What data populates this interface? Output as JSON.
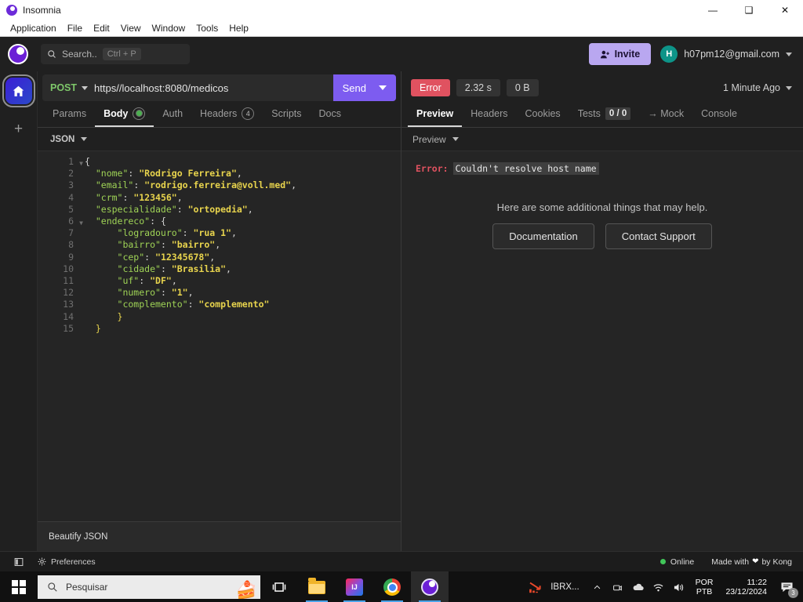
{
  "window": {
    "title": "Insomnia",
    "logo_icon": "insomnia-logo-icon",
    "minimize_label": "—",
    "maximize_label": "❑",
    "close_label": "✕"
  },
  "menubar": {
    "items": [
      {
        "label": "Application"
      },
      {
        "label": "File"
      },
      {
        "label": "Edit"
      },
      {
        "label": "View"
      },
      {
        "label": "Window"
      },
      {
        "label": "Tools"
      },
      {
        "label": "Help"
      }
    ]
  },
  "apptop": {
    "search": {
      "placeholder": "Search..",
      "shortcut": "Ctrl + P",
      "icon": "search-icon"
    },
    "invite_label": "Invite",
    "invite_icon": "add-user-icon",
    "account": {
      "initial": "H",
      "email": "h07pm12@gmail.com"
    }
  },
  "rail": {
    "home_icon": "home-icon",
    "add_label": "+"
  },
  "request": {
    "method": "POST",
    "url": "https//localhost:8080/medicos",
    "send_label": "Send",
    "tabs": [
      {
        "label": "Params",
        "active": false
      },
      {
        "label": "Body",
        "active": true,
        "badge_dot": true
      },
      {
        "label": "Auth",
        "active": false
      },
      {
        "label": "Headers",
        "active": false,
        "badge": "4"
      },
      {
        "label": "Scripts",
        "active": false
      },
      {
        "label": "Docs",
        "active": false
      }
    ],
    "editor": {
      "mode": "JSON",
      "beautify_label": "Beautify JSON",
      "lines": [
        {
          "n": 1,
          "fold": true,
          "tokens": [
            {
              "t": "{",
              "c": "p"
            }
          ]
        },
        {
          "n": 2,
          "fold": false,
          "tokens": [
            {
              "t": "  \"nome\"",
              "c": "k"
            },
            {
              "t": ": ",
              "c": "p"
            },
            {
              "t": "\"Rodrigo Ferreira\"",
              "c": "s"
            },
            {
              "t": ",",
              "c": "p"
            }
          ]
        },
        {
          "n": 3,
          "fold": false,
          "tokens": [
            {
              "t": "  \"email\"",
              "c": "k"
            },
            {
              "t": ": ",
              "c": "p"
            },
            {
              "t": "\"rodrigo.ferreira@voll.med\"",
              "c": "s"
            },
            {
              "t": ",",
              "c": "p"
            }
          ]
        },
        {
          "n": 4,
          "fold": false,
          "tokens": [
            {
              "t": "  \"crm\"",
              "c": "k"
            },
            {
              "t": ": ",
              "c": "p"
            },
            {
              "t": "\"123456\"",
              "c": "s"
            },
            {
              "t": ",",
              "c": "p"
            }
          ]
        },
        {
          "n": 5,
          "fold": false,
          "tokens": [
            {
              "t": "  \"especialidade\"",
              "c": "k"
            },
            {
              "t": ": ",
              "c": "p"
            },
            {
              "t": "\"ortopedia\"",
              "c": "s"
            },
            {
              "t": ",",
              "c": "p"
            }
          ]
        },
        {
          "n": 6,
          "fold": true,
          "tokens": [
            {
              "t": "  \"endereco\"",
              "c": "k"
            },
            {
              "t": ": ",
              "c": "p"
            },
            {
              "t": "{",
              "c": "p"
            }
          ]
        },
        {
          "n": 7,
          "fold": false,
          "tokens": [
            {
              "t": "      \"logradouro\"",
              "c": "k"
            },
            {
              "t": ": ",
              "c": "p"
            },
            {
              "t": "\"rua 1\"",
              "c": "s"
            },
            {
              "t": ",",
              "c": "p"
            }
          ]
        },
        {
          "n": 8,
          "fold": false,
          "tokens": [
            {
              "t": "      \"bairro\"",
              "c": "k"
            },
            {
              "t": ": ",
              "c": "p"
            },
            {
              "t": "\"bairro\"",
              "c": "s"
            },
            {
              "t": ",",
              "c": "p"
            }
          ]
        },
        {
          "n": 9,
          "fold": false,
          "tokens": [
            {
              "t": "      \"cep\"",
              "c": "k"
            },
            {
              "t": ": ",
              "c": "p"
            },
            {
              "t": "\"12345678\"",
              "c": "s"
            },
            {
              "t": ",",
              "c": "p"
            }
          ]
        },
        {
          "n": 10,
          "fold": false,
          "tokens": [
            {
              "t": "      \"cidade\"",
              "c": "k"
            },
            {
              "t": ": ",
              "c": "p"
            },
            {
              "t": "\"Brasilia\"",
              "c": "s"
            },
            {
              "t": ",",
              "c": "p"
            }
          ]
        },
        {
          "n": 11,
          "fold": false,
          "tokens": [
            {
              "t": "      \"uf\"",
              "c": "k"
            },
            {
              "t": ": ",
              "c": "p"
            },
            {
              "t": "\"DF\"",
              "c": "s"
            },
            {
              "t": ",",
              "c": "p"
            }
          ]
        },
        {
          "n": 12,
          "fold": false,
          "tokens": [
            {
              "t": "      \"numero\"",
              "c": "k"
            },
            {
              "t": ": ",
              "c": "p"
            },
            {
              "t": "\"1\"",
              "c": "s"
            },
            {
              "t": ",",
              "c": "p"
            }
          ]
        },
        {
          "n": 13,
          "fold": false,
          "tokens": [
            {
              "t": "      \"complemento\"",
              "c": "k"
            },
            {
              "t": ": ",
              "c": "p"
            },
            {
              "t": "\"complemento\"",
              "c": "s"
            }
          ]
        },
        {
          "n": 14,
          "fold": false,
          "tokens": [
            {
              "t": "      }",
              "c": "b"
            }
          ]
        },
        {
          "n": 15,
          "fold": false,
          "tokens": [
            {
              "t": "  }",
              "c": "b"
            }
          ]
        }
      ]
    }
  },
  "response": {
    "status_label": "Error",
    "time_label": "2.32 s",
    "size_label": "0 B",
    "history_label": "1 Minute Ago",
    "tabs": [
      {
        "label": "Preview",
        "active": true
      },
      {
        "label": "Headers",
        "active": false
      },
      {
        "label": "Cookies",
        "active": false
      },
      {
        "label": "Tests",
        "active": false,
        "badge": "0 / 0"
      },
      {
        "label": "→ Mock",
        "active": false
      },
      {
        "label": "Console",
        "active": false
      }
    ],
    "preview_mode": "Preview",
    "error_label": "Error:",
    "error_message": "Couldn't resolve host name",
    "help_text": "Here are some additional things that may help.",
    "help_buttons": [
      {
        "label": "Documentation"
      },
      {
        "label": "Contact Support"
      }
    ]
  },
  "statusbar": {
    "toggle_icon": "sidebar-toggle-icon",
    "preferences_label": "Preferences",
    "preferences_icon": "gear-icon",
    "online_label": "Online",
    "made_with_prefix": "Made with",
    "made_with_suffix": "by Kong",
    "heart_icon": "heart-icon"
  },
  "taskbar": {
    "start_icon": "windows-start-icon",
    "search_placeholder": "Pesquisar",
    "search_icon": "search-icon",
    "decoration_icon": "cake-icon",
    "apps": [
      {
        "name": "task-view-icon"
      },
      {
        "name": "file-explorer-icon"
      },
      {
        "name": "intellij-idea-icon",
        "label": "IJ"
      },
      {
        "name": "google-chrome-icon"
      },
      {
        "name": "insomnia-icon"
      }
    ],
    "tray": {
      "stock_label": "IBRX...",
      "stock_icon": "stock-down-icon",
      "chevron_icon": "chevron-up-icon",
      "camera_icon": "camera-icon",
      "onedrive_icon": "onedrive-icon",
      "wifi_icon": "wifi-icon",
      "volume_icon": "volume-icon",
      "lang_line1": "POR",
      "lang_line2": "PTB",
      "time": "11:22",
      "date": "23/12/2024",
      "notification_icon": "notification-icon",
      "notification_count": "3"
    }
  },
  "colors": {
    "accent": "#7d5cf0",
    "error": "#e05260",
    "method": "#7ec76a",
    "online": "#41c659"
  }
}
